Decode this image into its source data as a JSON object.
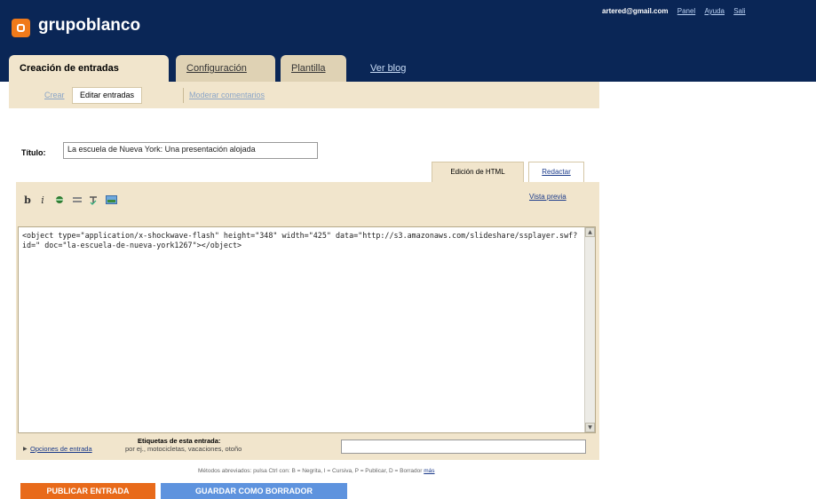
{
  "header": {
    "blog_name": "grupoblanco",
    "user_email": "artered@gmail.com",
    "links": [
      "Panel",
      "Ayuda",
      "Sali"
    ]
  },
  "main_tabs": {
    "active": "Creación de entradas",
    "config": "Configuración",
    "template": "Plantilla",
    "view_blog": "Ver blog"
  },
  "sub_tabs": {
    "create": "Crear",
    "edit": "Editar entradas",
    "moderate": "Moderar comentarios"
  },
  "post": {
    "title_label": "Título:",
    "title_value": "La escuela de Nueva York: Una presentación alojada"
  },
  "editor": {
    "tab_html": "Edición de HTML",
    "tab_compose": "Redactar",
    "preview": "Vista previa",
    "content": "<object type=\"application/x-shockwave-flash\" height=\"348\" width=\"425\" data=\"http://s3.amazonaws.com/slideshare/ssplayer.swf?id=\" doc=\"la-escuela-de-nueva-york1267\"></object>",
    "toolbar": {
      "bold": "b",
      "italic": "i"
    }
  },
  "labels": {
    "options_link": "Opciones de entrada",
    "title": "Etiquetas de esta entrada:",
    "hint": "por ej., motocicletas, vacaciones, otoño"
  },
  "shortcuts": {
    "text": "Métodos abreviados: pulsa Ctrl con: B = Negrita, I = Cursiva, P = Publicar, D = Borrador",
    "more_link": "más"
  },
  "buttons": {
    "publish": "PUBLICAR ENTRADA",
    "save_draft": "GUARDAR COMO BORRADOR"
  }
}
